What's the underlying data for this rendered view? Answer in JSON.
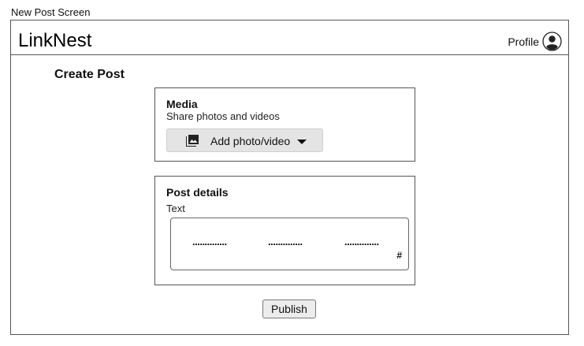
{
  "screen_label": "New Post Screen",
  "header": {
    "app_title": "LinkNest",
    "profile_label": "Profile",
    "avatar_icon": "user-circle-icon"
  },
  "main": {
    "page_title": "Create Post",
    "media_card": {
      "title": "Media",
      "subtitle": "Share photos and videos",
      "add_button_label": "Add photo/video",
      "add_button_icon": "photo-library-icon",
      "dropdown_icon": "caret-down-icon"
    },
    "details_card": {
      "title": "Post details",
      "text_label": "Text",
      "text_placeholder_segments": [
        "..............",
        "..............",
        ".............."
      ],
      "hashtag_icon_glyph": "#"
    },
    "publish_label": "Publish"
  }
}
